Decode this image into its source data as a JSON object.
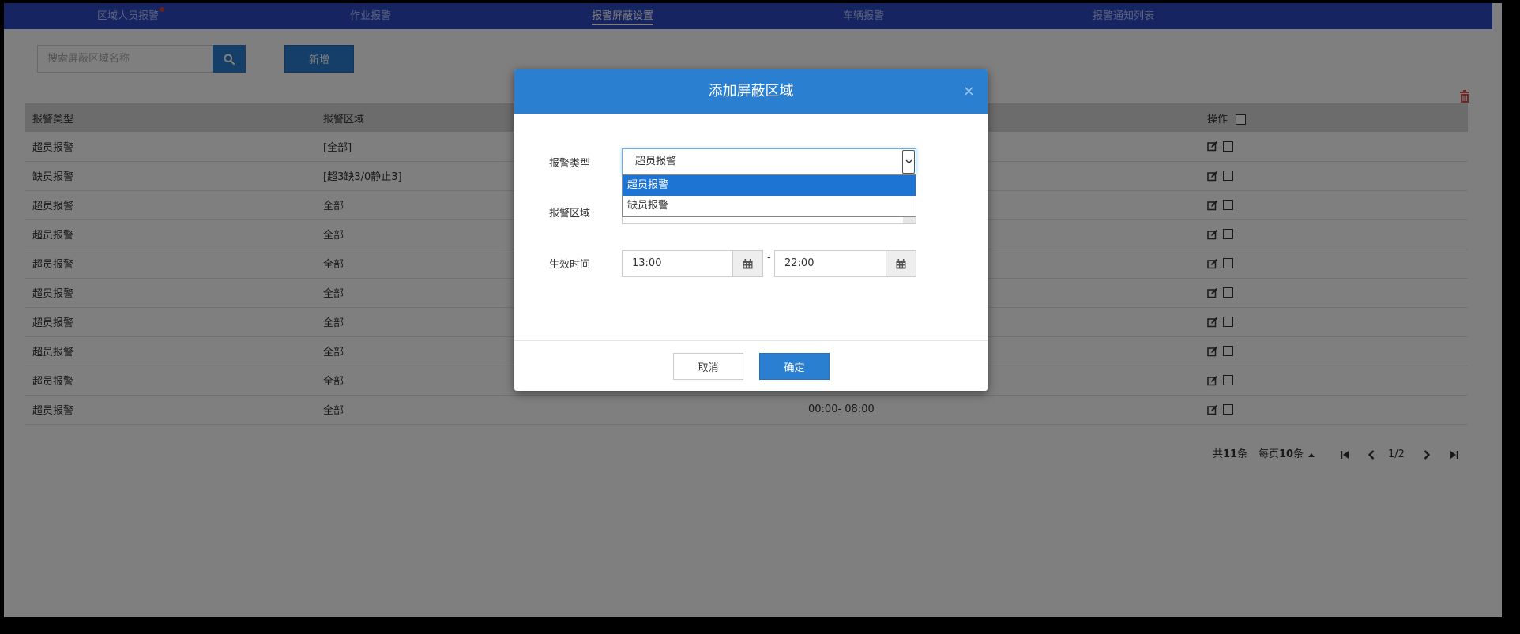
{
  "nav": {
    "items": [
      {
        "label": "区域人员报警",
        "active": false,
        "has_dot": true
      },
      {
        "label": "作业报警",
        "active": false,
        "has_dot": false
      },
      {
        "label": "报警屏蔽设置",
        "active": true,
        "has_dot": false
      },
      {
        "label": "车辆报警",
        "active": false,
        "has_dot": false
      },
      {
        "label": "报警通知列表",
        "active": false,
        "has_dot": false
      }
    ]
  },
  "toolbar": {
    "search_placeholder": "搜索屏蔽区域名称",
    "add_label": "新增"
  },
  "table": {
    "headers": [
      "报警类型",
      "报警区域",
      "",
      "操作"
    ],
    "rows": [
      {
        "type": "超员报警",
        "area": "[全部]",
        "time": ""
      },
      {
        "type": "缺员报警",
        "area": "[超3缺3/0静止3]",
        "time": ""
      },
      {
        "type": "超员报警",
        "area": "全部",
        "time": ""
      },
      {
        "type": "超员报警",
        "area": "全部",
        "time": ""
      },
      {
        "type": "超员报警",
        "area": "全部",
        "time": ""
      },
      {
        "type": "超员报警",
        "area": "全部",
        "time": ""
      },
      {
        "type": "超员报警",
        "area": "全部",
        "time": ""
      },
      {
        "type": "超员报警",
        "area": "全部",
        "time": ""
      },
      {
        "type": "超员报警",
        "area": "全部",
        "time": ""
      },
      {
        "type": "超员报警",
        "area": "全部",
        "time": "00:00- 08:00"
      }
    ]
  },
  "pagination": {
    "total_prefix": "共",
    "total": "11",
    "total_suffix": "条",
    "per_page_prefix": "每页",
    "per_page": "10",
    "per_page_suffix": "条",
    "page_display": "1/2"
  },
  "modal": {
    "title": "添加屏蔽区域",
    "close_symbol": "×",
    "type_label": "报警类型",
    "type_value": "超员报警",
    "type_options": [
      "超员报警",
      "缺员报警"
    ],
    "area_label": "报警区域",
    "time_label": "生效时间",
    "start_time": "13:00",
    "time_separator": "-",
    "end_time": "22:00",
    "cancel_label": "取消",
    "confirm_label": "确定"
  },
  "colors": {
    "nav_bg": "#2c4bc4",
    "primary": "#2a7fd0",
    "dropdown_selected": "#1e74d2",
    "trash": "#d9534f"
  }
}
